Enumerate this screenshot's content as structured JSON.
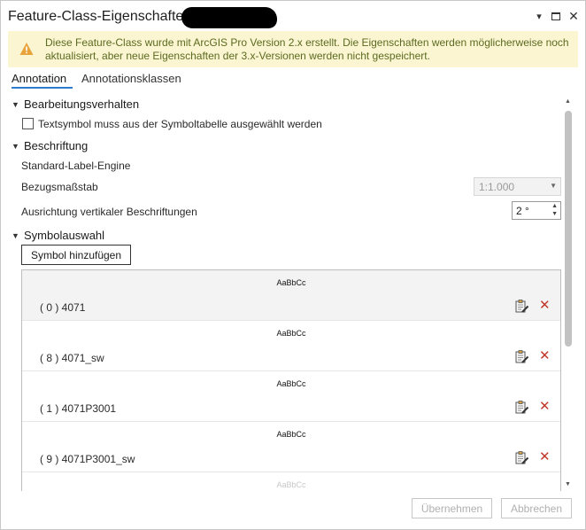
{
  "window": {
    "title": "Feature-Class-Eigenschaften:"
  },
  "banner": {
    "text": "Diese Feature-Class wurde mit ArcGIS Pro Version 2.x erstellt. Die Eigenschaften werden möglicherweise noch aktualisiert, aber neue Eigenschaften der 3.x-Versionen werden nicht gespeichert.",
    "icon": "warning-icon",
    "color": "#fbf5d2"
  },
  "tabs": [
    {
      "label": "Annotation",
      "active": true
    },
    {
      "label": "Annotationsklassen",
      "active": false
    }
  ],
  "sections": {
    "editing": {
      "title": "Bearbeitungsverhalten",
      "checkbox_label": "Textsymbol muss aus der Symboltabelle ausgewählt werden",
      "checked": false
    },
    "labeling": {
      "title": "Beschriftung",
      "engine_label": "Standard-Label-Engine",
      "scale_label": "Bezugsmaßstab",
      "scale_value": "1:1.000",
      "vertical_label": "Ausrichtung vertikaler Beschriftungen",
      "vertical_value": "2 °"
    },
    "symbols": {
      "title": "Symbolauswahl",
      "add_button": "Symbol hinzufügen",
      "items": [
        {
          "preview": "AaBbCc",
          "name": "( 0 )  4071"
        },
        {
          "preview": "AaBbCc",
          "name": "( 8 )  4071_sw"
        },
        {
          "preview": "AaBbCc",
          "name": "( 1 )  4071P3001"
        },
        {
          "preview": "AaBbCc",
          "name": "( 9 )  4071P3001_sw"
        },
        {
          "preview": "AaBbCc",
          "name": ""
        }
      ]
    }
  },
  "footer": {
    "apply_label": "Übernehmen",
    "cancel_label": "Abbrechen"
  },
  "colors": {
    "accent": "#2e7bcf",
    "delete": "#c0392b",
    "banner_text": "#5b6b1f"
  }
}
